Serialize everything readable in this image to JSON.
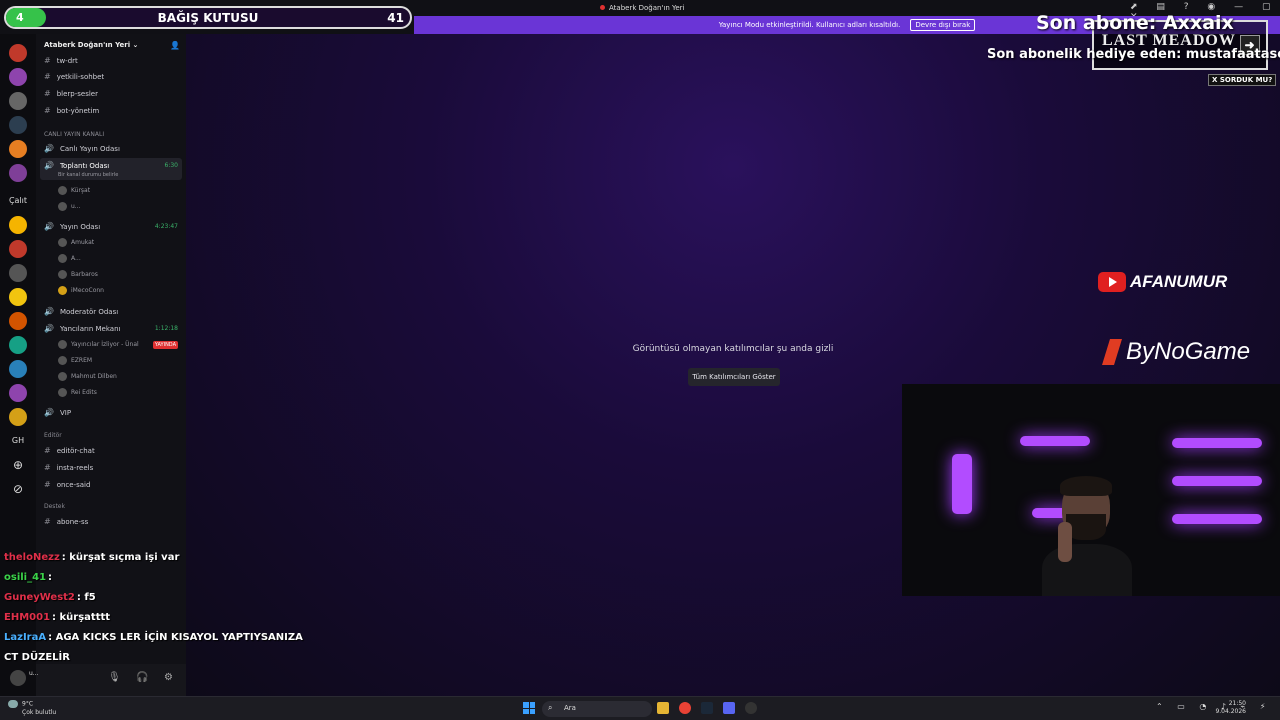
{
  "window": {
    "title": "Ataberk Doğan'ın Yeri"
  },
  "streamer_mode": {
    "text": "Yayıncı Modu etkinleştirildi. Kullanıcı adları kısaltıldı.",
    "button": "Devre dışı bırak"
  },
  "donation": {
    "left_value": "4",
    "title": "BAĞIŞ KUTUSU",
    "right_value": "41",
    "progress_fraction": 0.1
  },
  "rail": {
    "label_1": "Çalıt",
    "label_2": "GH"
  },
  "server": {
    "name": "Ataberk Doğan'ın Yeri"
  },
  "channels": {
    "tw_drt": "tw-drt",
    "yetkili": "yetkili-sohbet",
    "blerp": "blerp-sesler",
    "bot": "bot-yönetim",
    "cat_live": "CANLI YAYIN KANALI",
    "canli": "Canlı Yayın Odası",
    "toplanti": "Toplantı Odası",
    "toplanti_status": "Bir kanal durumu belirle",
    "toplanti_time": "6:30",
    "toplanti_u1": "Kürşat",
    "toplanti_u2": "u...",
    "yayin": "Yayın Odası",
    "yayin_time": "4:23:47",
    "yayin_u1": "Amukat",
    "yayin_u2": "A...",
    "yayin_u3": "Barbaros",
    "yayin_u4": "iMecoConn",
    "moderator": "Moderatör Odası",
    "yancilar": "Yancıların Mekanı",
    "yancilar_time": "1:12:18",
    "yancilar_u1": "Yayıncılar İzliyor - Ünal",
    "yancilar_live": "YAYINDA",
    "yancilar_u2": "EZREM",
    "yancilar_u3": "Mahmut Dilben",
    "yancilar_u4": "Rei Edits",
    "vip": "VIP",
    "cat_editor": "Editör",
    "editor_chat": "editör-chat",
    "insta": "insta-reels",
    "once": "once-said",
    "cat_destek": "Destek",
    "abone": "abone-ss"
  },
  "main": {
    "hidden_msg": "Görüntüsü olmayan katılımcılar şu anda gizli",
    "show_button": "Tüm Katılımcıları Göster"
  },
  "overlay": {
    "last_sub": "Son abone: Axxaix",
    "gift_sub": "Son abonelik hediye eden: mustafaatasevrr",
    "last_meadow": "LAST MEADOW",
    "sorduk": "X SORDUK MU?",
    "youtube_name": "AFANUMUR",
    "sponsor": "ByNoGame"
  },
  "chat": [
    {
      "user": "theloNezz",
      "color": "#e0304a",
      "text": ": kürşat sıçma işi var"
    },
    {
      "user": "osili_41",
      "color": "#3bd44a",
      "text": ":"
    },
    {
      "user": "GuneyWest2",
      "color": "#e0304a",
      "text": ": f5"
    },
    {
      "user": "EHM001",
      "color": "#e0304a",
      "text": ": kürşatttt"
    },
    {
      "user": "LazIraA",
      "color": "#4ab0ff",
      "text": ": AGA KICKS LER İÇİN KISAYOL YAPTIYSANIZA CT DÜZELİR"
    }
  ],
  "userpanel": {
    "name": "u..."
  },
  "taskbar": {
    "weather_temp": "9°C",
    "weather_desc": "Çok bulutlu",
    "search": "Ara",
    "time": "21:50",
    "date": "9.04.2026"
  }
}
